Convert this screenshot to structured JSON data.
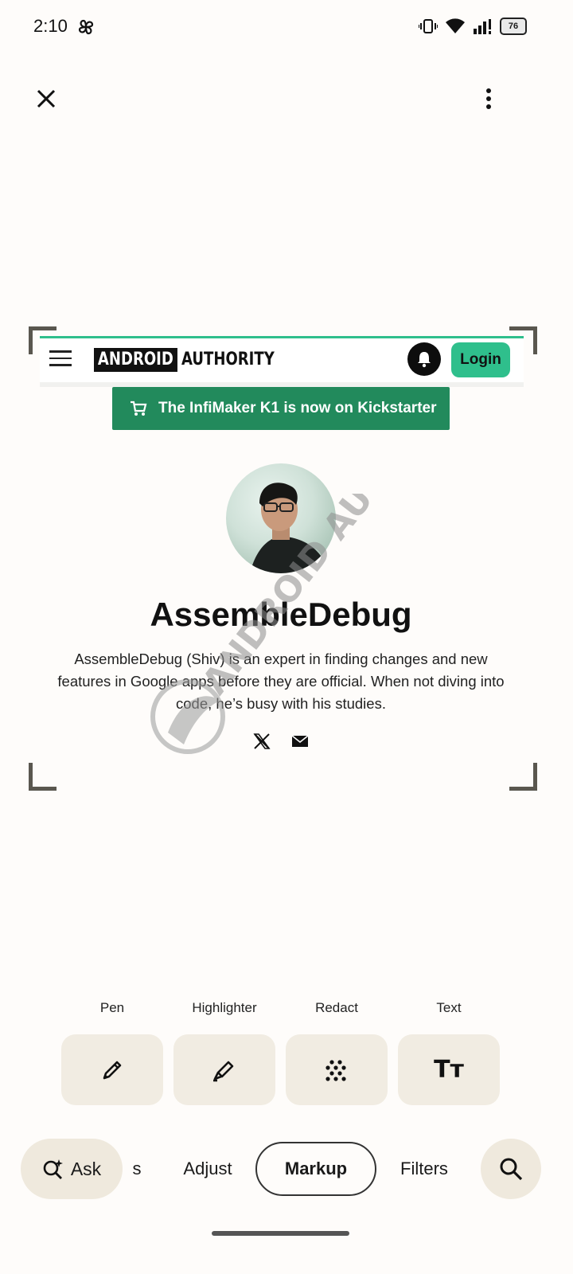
{
  "status_bar": {
    "time": "2:10",
    "battery": "76"
  },
  "site": {
    "logo_part1": "ANDROID",
    "logo_part2": "AUTHORITY",
    "login_label": "Login",
    "promo_text": "The InfiMaker K1 is now on Kickstarter",
    "author_name": "AssembleDebug",
    "author_bio": "AssembleDebug (Shiv) is an expert in finding changes and new features in Google apps before they are official. When not diving into code, he’s busy with his studies.",
    "watermark_text": "ANDROID AUTHORITY"
  },
  "tools": [
    {
      "label": "Pen",
      "icon": "pen-icon"
    },
    {
      "label": "Highlighter",
      "icon": "highlighter-icon"
    },
    {
      "label": "Redact",
      "icon": "redact-icon"
    },
    {
      "label": "Text",
      "icon": "text-icon",
      "glyph": "Tт"
    }
  ],
  "bottom_tabs": {
    "ask": "Ask",
    "partial": "s",
    "adjust": "Adjust",
    "markup": "Markup",
    "filters": "Filters",
    "selected": "Markup"
  },
  "colors": {
    "accent": "#2fbf8c",
    "banner": "#228a5c",
    "tool_bg": "#f1ece2"
  }
}
